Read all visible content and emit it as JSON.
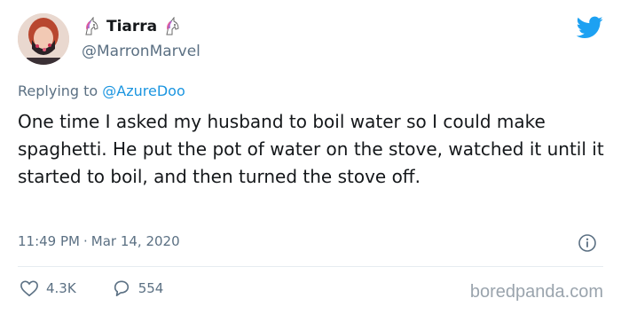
{
  "user": {
    "display_name": "Tiarra",
    "handle": "@MarronMarvel"
  },
  "reply": {
    "prefix": "Replying to ",
    "mention": "@AzureDoo"
  },
  "tweet": {
    "text": "One time I asked my husband to boil water so I could make spaghetti. He put the pot of water on the stove, watched it until it started to boil, and then turned the stove off."
  },
  "meta": {
    "time": "11:49 PM",
    "separator": "·",
    "date": "Mar 14, 2020"
  },
  "actions": {
    "likes": "4.3K",
    "replies": "554"
  },
  "watermark": "boredpanda.com",
  "colors": {
    "twitter_blue": "#1da1f2",
    "muted": "#5b7083",
    "mention": "#1b95e0"
  },
  "icons": {
    "name_emoji": "unicorn-icon",
    "brand": "twitter-logo-icon",
    "info": "info-icon",
    "like": "heart-icon",
    "reply": "reply-icon"
  }
}
